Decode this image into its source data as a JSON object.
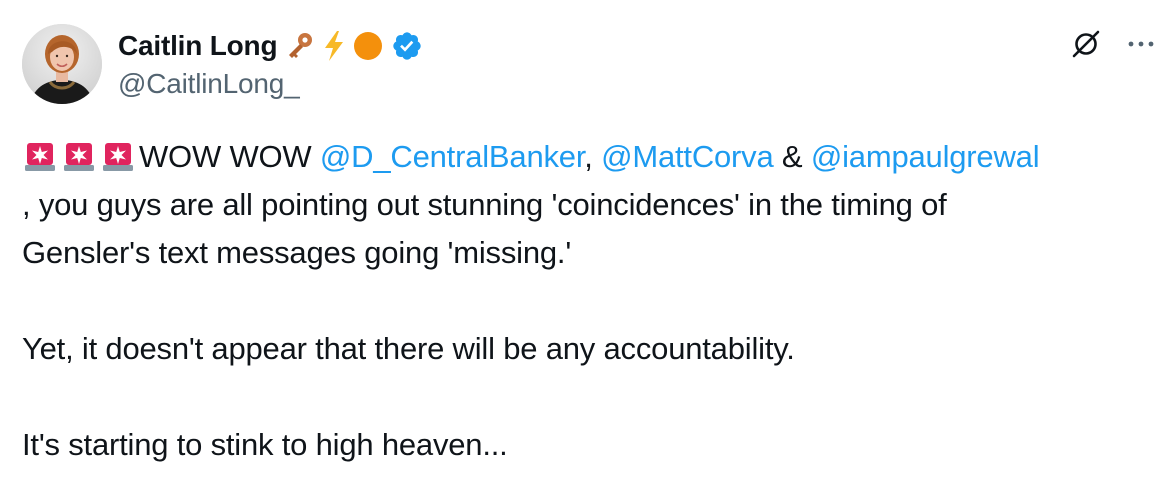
{
  "author": {
    "display_name": "Caitlin Long",
    "handle": "@CaitlinLong_",
    "name_emojis": [
      "key-emoji",
      "lightning-emoji",
      "orange-circle-emoji",
      "verified-badge-icon"
    ]
  },
  "actions": {
    "grok_icon": "grok-icon",
    "more_icon": "more-icon"
  },
  "tweet": {
    "line1_prefix": "WOW WOW ",
    "mention1": "@D_CentralBanker",
    "sep1": ", ",
    "mention2": "@MattCorva",
    "sep2": " & ",
    "mention3": "@iampaulgrewal",
    "line2": ", you guys are all pointing out stunning 'coincidences' in the timing of",
    "line3": "Gensler's text messages going 'missing.'",
    "line4": "Yet, it doesn't appear that there will be any accountability.",
    "line5": "It's starting to stink to high heaven..."
  },
  "colors": {
    "text": "#0f1419",
    "secondary": "#536471",
    "link": "#1d9bf0",
    "verified": "#1d9bf0"
  }
}
